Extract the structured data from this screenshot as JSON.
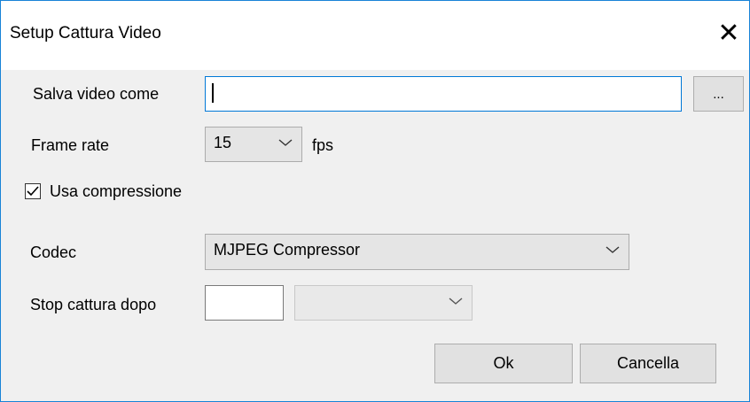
{
  "window": {
    "title": "Setup Cattura Video",
    "close_glyph": "✕"
  },
  "save_as": {
    "label": "Salva video come",
    "value": "",
    "browse_label": "..."
  },
  "frame_rate": {
    "label": "Frame rate",
    "selected": "15",
    "unit": "fps"
  },
  "compression": {
    "label": "Usa compressione",
    "checked": true
  },
  "codec": {
    "label": "Codec",
    "selected": "MJPEG Compressor"
  },
  "stop_capture": {
    "label": "Stop cattura dopo",
    "value": "",
    "unit_selected": ""
  },
  "buttons": {
    "ok": "Ok",
    "cancel": "Cancella"
  },
  "colors": {
    "accent": "#0078d7",
    "window_border": "#1883d7",
    "dialog_bg": "#f0f0f0"
  }
}
